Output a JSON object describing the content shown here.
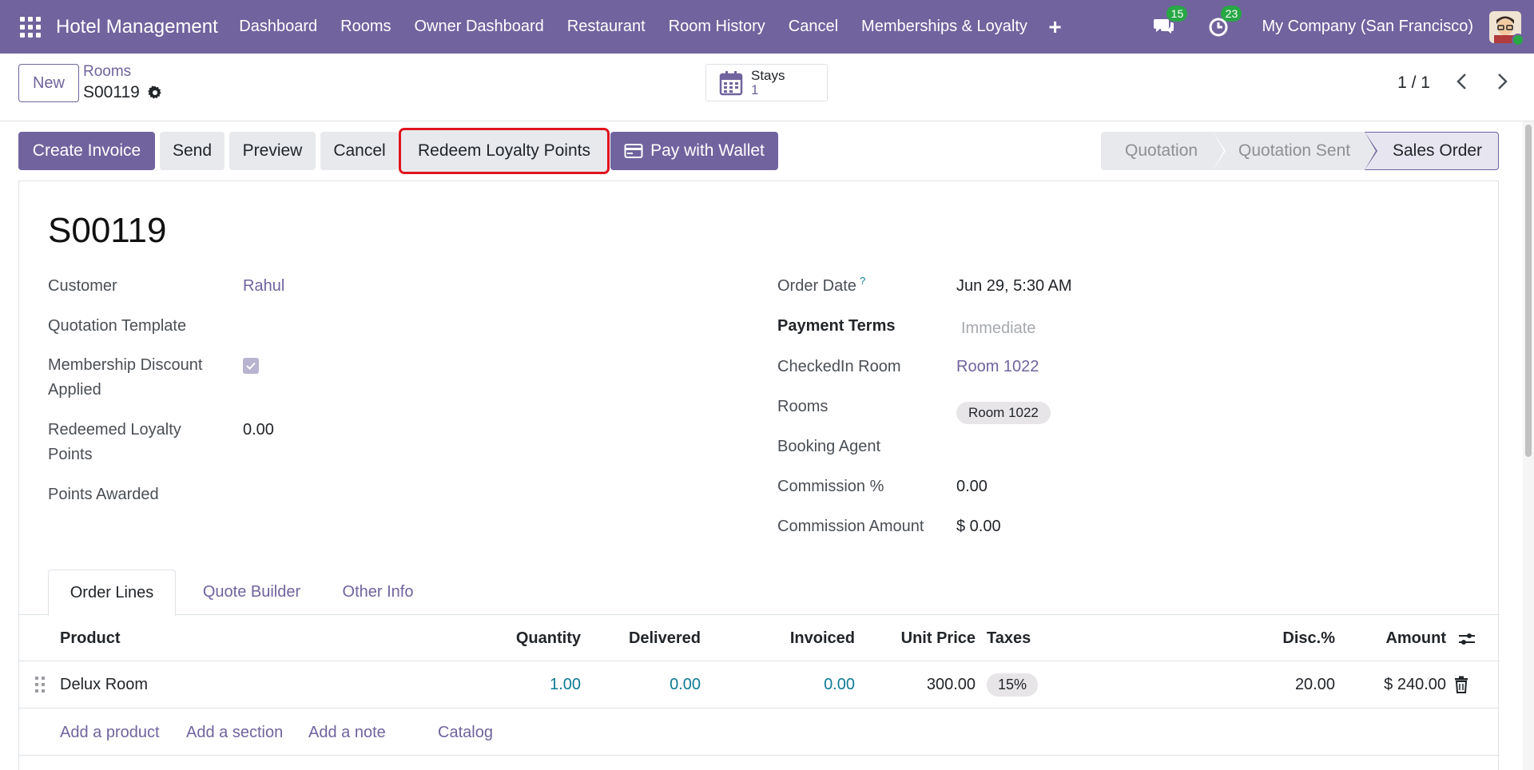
{
  "navbar": {
    "brand": "Hotel Management",
    "menu": [
      {
        "label": "Dashboard"
      },
      {
        "label": "Rooms"
      },
      {
        "label": "Owner Dashboard"
      },
      {
        "label": "Restaurant"
      },
      {
        "label": "Room History"
      },
      {
        "label": "Cancel"
      },
      {
        "label": "Memberships & Loyalty"
      }
    ],
    "plus": "+",
    "messages_count": "15",
    "activities_count": "23",
    "company": "My Company (San Francisco)"
  },
  "control_panel": {
    "new_label": "New",
    "breadcrumb_parent": "Rooms",
    "breadcrumb_current": "S00119",
    "stat": {
      "label": "Stays",
      "value": "1"
    },
    "pager": "1 / 1"
  },
  "statusbar": {
    "buttons": {
      "create_invoice": "Create Invoice",
      "send": "Send",
      "preview": "Preview",
      "cancel": "Cancel",
      "redeem": "Redeem Loyalty Points",
      "wallet": "Pay with Wallet"
    },
    "stages": [
      "Quotation",
      "Quotation Sent",
      "Sales Order"
    ],
    "active_stage": "Sales Order"
  },
  "form": {
    "name": "S00119",
    "left": {
      "customer_label": "Customer",
      "customer_value": "Rahul",
      "template_label": "Quotation Template",
      "membership_label_1": "Membership Discount",
      "membership_label_2": "Applied",
      "membership_checked": true,
      "redeemed_label_1": "Redeemed Loyalty",
      "redeemed_label_2": "Points",
      "redeemed_value": "0.00",
      "awarded_label": "Points Awarded"
    },
    "right": {
      "order_date_label": "Order Date",
      "order_date_help": "?",
      "order_date_value": "Jun 29, 5:30 AM",
      "payment_terms_label": "Payment Terms",
      "payment_terms_placeholder": "Immediate",
      "checkin_label": "CheckedIn Room",
      "checkin_value": "Room 1022",
      "rooms_label": "Rooms",
      "rooms_tag": "Room 1022",
      "agent_label": "Booking Agent",
      "commission_pct_label": "Commission %",
      "commission_pct_value": "0.00",
      "commission_amt_label": "Commission Amount",
      "commission_amt_value": "$ 0.00"
    }
  },
  "tabs": [
    "Order Lines",
    "Quote Builder",
    "Other Info"
  ],
  "order_lines": {
    "columns": {
      "product": "Product",
      "quantity": "Quantity",
      "delivered": "Delivered",
      "invoiced": "Invoiced",
      "unit_price": "Unit Price",
      "taxes": "Taxes",
      "discount": "Disc.%",
      "amount": "Amount"
    },
    "rows": [
      {
        "product": "Delux Room",
        "quantity": "1.00",
        "delivered": "0.00",
        "invoiced": "0.00",
        "unit_price": "300.00",
        "taxes": "15%",
        "discount": "20.00",
        "amount": "$ 240.00"
      }
    ],
    "add_links": {
      "product": "Add a product",
      "section": "Add a section",
      "note": "Add a note",
      "catalog": "Catalog"
    }
  },
  "colors": {
    "brand": "#71639e",
    "teal": "#0c7b93",
    "badge_green": "#28a745",
    "highlight_red": "#e0141e"
  }
}
